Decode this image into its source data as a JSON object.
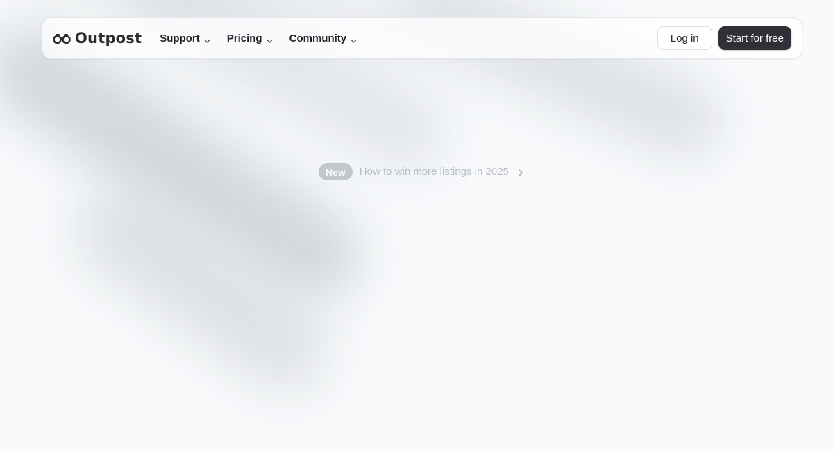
{
  "brand": {
    "name": "Outpost",
    "icon": "binoculars-icon"
  },
  "nav": {
    "items": [
      {
        "label": "Support",
        "icon": "chevron-down-icon"
      },
      {
        "label": "Pricing",
        "icon": "chevron-down-icon"
      },
      {
        "label": "Community",
        "icon": "chevron-down-icon"
      }
    ]
  },
  "actions": {
    "login_label": "Log in",
    "start_label": "Start for free"
  },
  "announcement": {
    "badge": "New",
    "text": "How to win more listings in 2025",
    "icon": "chevron-right-icon"
  },
  "colors": {
    "background": "#f8fafc",
    "primary_button": "#2f3038",
    "text_dark": "#1f2328"
  }
}
